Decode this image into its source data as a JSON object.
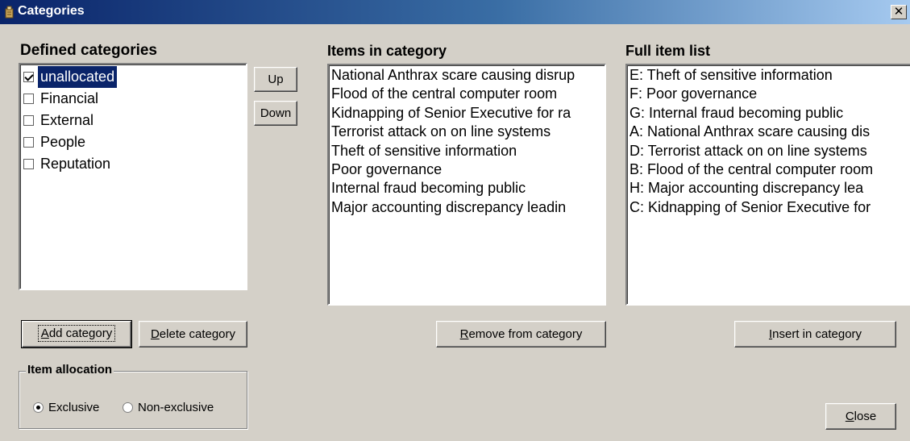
{
  "window": {
    "title": "Categories",
    "close_glyph": "✕"
  },
  "defined_categories": {
    "heading": "Defined categories",
    "items": [
      {
        "label": "unallocated",
        "checked": true,
        "selected": true
      },
      {
        "label": "Financial",
        "checked": false,
        "selected": false
      },
      {
        "label": "External",
        "checked": false,
        "selected": false
      },
      {
        "label": "People",
        "checked": false,
        "selected": false
      },
      {
        "label": "Reputation",
        "checked": false,
        "selected": false
      }
    ],
    "up_label": "Up",
    "down_label": "Down",
    "add_button": {
      "mnemonic": "A",
      "rest": "dd category"
    },
    "delete_button": {
      "mnemonic": "D",
      "rest": "elete category"
    }
  },
  "items_in_category": {
    "heading": "Items in category",
    "items": [
      "National Anthrax scare causing disrup",
      "Flood of the central computer room",
      "Kidnapping of Senior Executive for ra",
      "Terrorist attack on on line systems",
      "Theft of sensitive information",
      "Poor governance",
      "Internal fraud becoming public",
      "Major accounting discrepancy leadin"
    ],
    "remove_button": {
      "mnemonic": "R",
      "rest": "emove from category"
    }
  },
  "full_item_list": {
    "heading": "Full item list",
    "items": [
      "E: Theft of sensitive information",
      "F: Poor governance",
      "G: Internal fraud becoming public",
      "A: National Anthrax scare causing dis",
      "D: Terrorist attack on on line systems",
      "B: Flood of the central computer room",
      "H: Major accounting discrepancy lea",
      "C: Kidnapping of Senior Executive for"
    ],
    "insert_button": {
      "mnemonic": "I",
      "rest": "nsert in category"
    }
  },
  "item_allocation": {
    "legend": "Item allocation",
    "exclusive_label": "Exclusive",
    "non_exclusive_label": "Non-exclusive",
    "selected": "exclusive"
  },
  "close_button": {
    "mnemonic": "C",
    "rest": "lose"
  }
}
